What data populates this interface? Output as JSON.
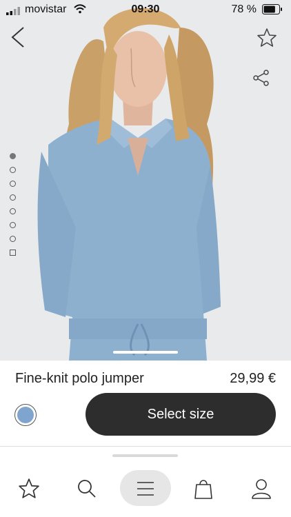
{
  "status_bar": {
    "carrier": "movistar",
    "time": "09:30",
    "battery": "78 %",
    "battery_level": 0.78
  },
  "product": {
    "name": "Fine-knit polo jumper",
    "price": "29,99 €",
    "color": "#7fa5cf"
  },
  "gallery": {
    "images_count": 7,
    "active_index": 0,
    "has_video": true
  },
  "actions": {
    "select_size": "Select size"
  },
  "icons": {
    "back": "chevron-left-icon",
    "favorite": "star-icon",
    "share": "share-icon"
  },
  "bottom_nav": {
    "items": [
      "star-icon",
      "search-icon",
      "menu-icon",
      "bag-icon",
      "user-icon"
    ],
    "active": "menu-icon"
  }
}
